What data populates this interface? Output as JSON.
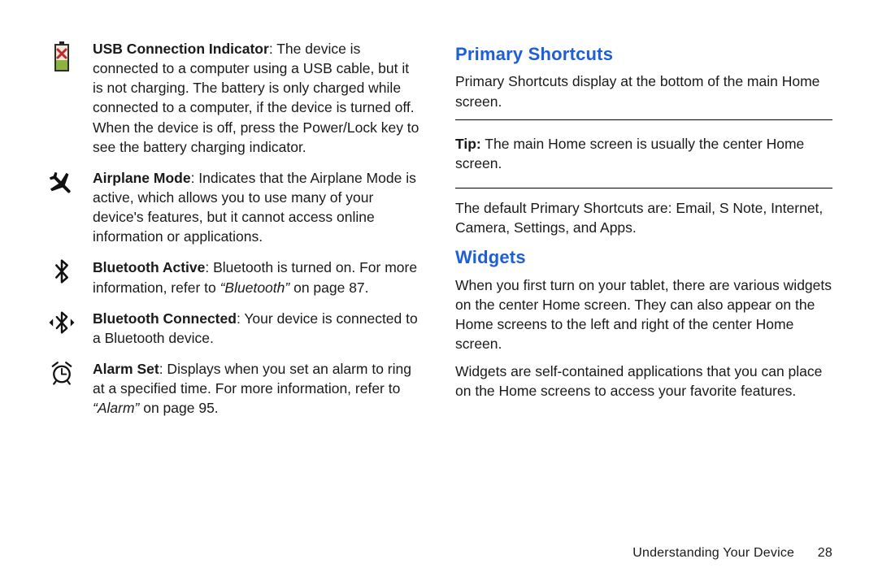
{
  "left": {
    "items": [
      {
        "icon": "battery-x-icon",
        "term": "USB Connection Indicator",
        "text": ": The device is connected to a computer using a USB cable, but it is not charging. The battery is only charged while connected to a computer, if the device is turned off. When the device is off, press the Power/Lock key to see the battery charging indicator."
      },
      {
        "icon": "airplane-icon",
        "term": "Airplane Mode",
        "text": ": Indicates that the Airplane Mode is active, which allows you to use many of your device's features, but it cannot access online information or applications."
      },
      {
        "icon": "bluetooth-icon",
        "term": "Bluetooth Active",
        "text_pre": ": Bluetooth is turned on. For more information, refer to ",
        "text_ital": "“Bluetooth”",
        "text_post": " on page 87."
      },
      {
        "icon": "bluetooth-connected-icon",
        "term": "Bluetooth Connected",
        "text": ": Your device is connected to a Bluetooth device."
      },
      {
        "icon": "alarm-icon",
        "term": "Alarm Set",
        "text_pre": ": Displays when you set an alarm to ring at a specified time. For more information, refer to ",
        "text_ital": "“Alarm”",
        "text_post": " on page 95."
      }
    ]
  },
  "right": {
    "primary_heading": "Primary Shortcuts",
    "primary_intro": "Primary Shortcuts display at the bottom of the main Home screen.",
    "tip_label": "Tip:",
    "tip_text": " The main Home screen is usually the center Home screen.",
    "primary_defaults": "The default Primary Shortcuts are: Email, S Note, Internet, Camera, Settings, and Apps.",
    "widgets_heading": "Widgets",
    "widgets_p1": "When you first turn on your tablet, there are various widgets on the center Home screen. They can also appear on the Home screens to the left and right of the center Home screen.",
    "widgets_p2": "Widgets are self-contained applications that you can place on the Home screens to access your favorite features."
  },
  "footer": {
    "section": "Understanding Your Device",
    "page": "28"
  }
}
